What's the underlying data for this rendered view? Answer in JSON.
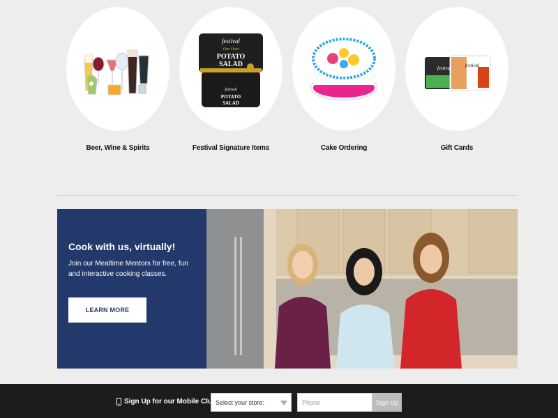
{
  "categories": [
    {
      "label": "Beer, Wine & Spirits",
      "icon": "glasses-image"
    },
    {
      "label": "Festival Signature Items",
      "icon": "potato-salad-image",
      "product": {
        "brand": "festival",
        "flavor": "Our Own",
        "name_line1": "POTATO",
        "name_line2": "SALAD"
      }
    },
    {
      "label": "Cake Ordering",
      "icon": "cake-image"
    },
    {
      "label": "Gift Cards",
      "icon": "gift-cards-image",
      "card_brand": "festival"
    }
  ],
  "promo": {
    "title": "Cook with us, virtually!",
    "text": "Join our Mealtime Mentors for free, fun and interactive cooking classes.",
    "button_label": "LEARN MORE",
    "background_color": "#23396b"
  },
  "footer": {
    "signup_label": "Sign Up for our Mobile Club",
    "store_select_value": "Select your store:",
    "phone_placeholder": "Phone",
    "signup_button": "Sign Up"
  }
}
